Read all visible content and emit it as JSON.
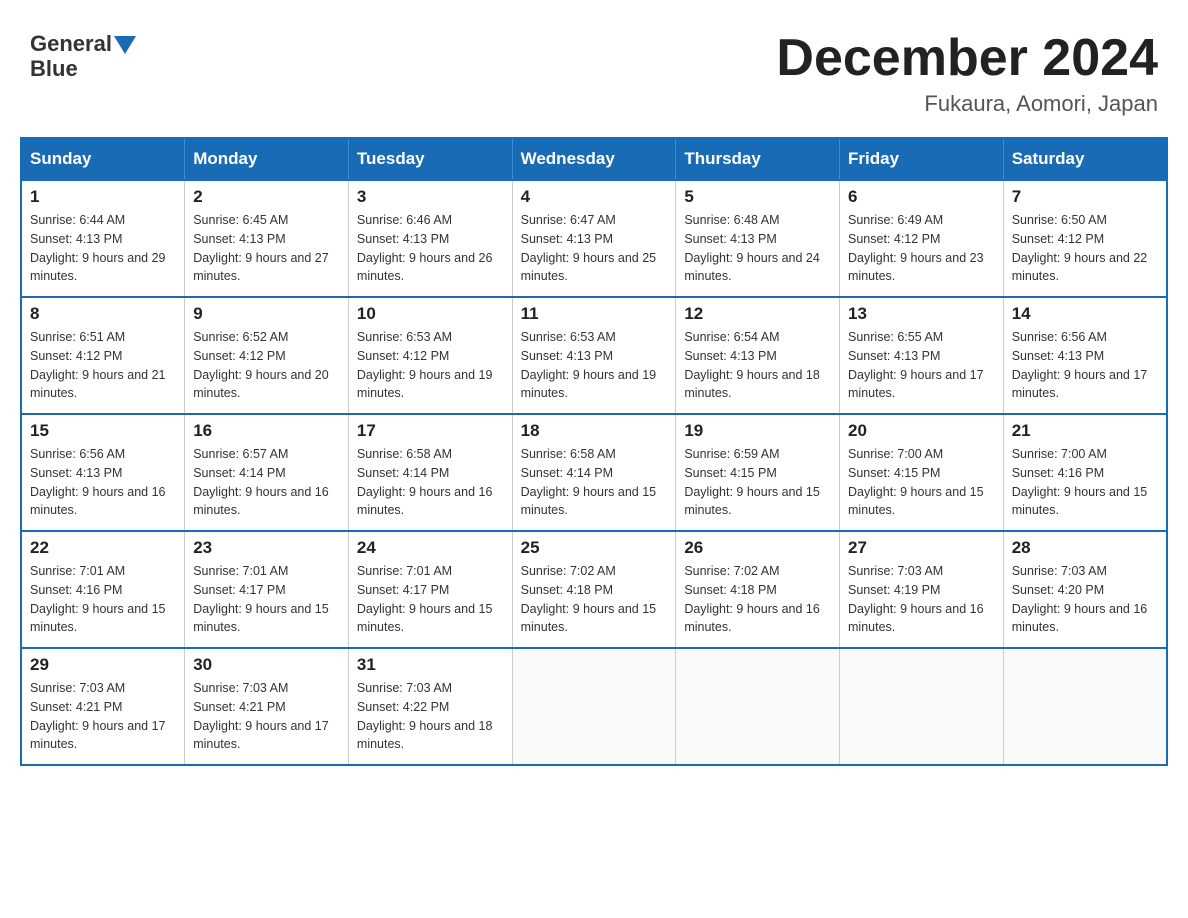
{
  "header": {
    "logo_text_general": "General",
    "logo_text_blue": "Blue",
    "month_title": "December 2024",
    "location": "Fukaura, Aomori, Japan"
  },
  "days_of_week": [
    "Sunday",
    "Monday",
    "Tuesday",
    "Wednesday",
    "Thursday",
    "Friday",
    "Saturday"
  ],
  "weeks": [
    [
      {
        "day": "1",
        "sunrise": "6:44 AM",
        "sunset": "4:13 PM",
        "daylight": "9 hours and 29 minutes."
      },
      {
        "day": "2",
        "sunrise": "6:45 AM",
        "sunset": "4:13 PM",
        "daylight": "9 hours and 27 minutes."
      },
      {
        "day": "3",
        "sunrise": "6:46 AM",
        "sunset": "4:13 PM",
        "daylight": "9 hours and 26 minutes."
      },
      {
        "day": "4",
        "sunrise": "6:47 AM",
        "sunset": "4:13 PM",
        "daylight": "9 hours and 25 minutes."
      },
      {
        "day": "5",
        "sunrise": "6:48 AM",
        "sunset": "4:13 PM",
        "daylight": "9 hours and 24 minutes."
      },
      {
        "day": "6",
        "sunrise": "6:49 AM",
        "sunset": "4:12 PM",
        "daylight": "9 hours and 23 minutes."
      },
      {
        "day": "7",
        "sunrise": "6:50 AM",
        "sunset": "4:12 PM",
        "daylight": "9 hours and 22 minutes."
      }
    ],
    [
      {
        "day": "8",
        "sunrise": "6:51 AM",
        "sunset": "4:12 PM",
        "daylight": "9 hours and 21 minutes."
      },
      {
        "day": "9",
        "sunrise": "6:52 AM",
        "sunset": "4:12 PM",
        "daylight": "9 hours and 20 minutes."
      },
      {
        "day": "10",
        "sunrise": "6:53 AM",
        "sunset": "4:12 PM",
        "daylight": "9 hours and 19 minutes."
      },
      {
        "day": "11",
        "sunrise": "6:53 AM",
        "sunset": "4:13 PM",
        "daylight": "9 hours and 19 minutes."
      },
      {
        "day": "12",
        "sunrise": "6:54 AM",
        "sunset": "4:13 PM",
        "daylight": "9 hours and 18 minutes."
      },
      {
        "day": "13",
        "sunrise": "6:55 AM",
        "sunset": "4:13 PM",
        "daylight": "9 hours and 17 minutes."
      },
      {
        "day": "14",
        "sunrise": "6:56 AM",
        "sunset": "4:13 PM",
        "daylight": "9 hours and 17 minutes."
      }
    ],
    [
      {
        "day": "15",
        "sunrise": "6:56 AM",
        "sunset": "4:13 PM",
        "daylight": "9 hours and 16 minutes."
      },
      {
        "day": "16",
        "sunrise": "6:57 AM",
        "sunset": "4:14 PM",
        "daylight": "9 hours and 16 minutes."
      },
      {
        "day": "17",
        "sunrise": "6:58 AM",
        "sunset": "4:14 PM",
        "daylight": "9 hours and 16 minutes."
      },
      {
        "day": "18",
        "sunrise": "6:58 AM",
        "sunset": "4:14 PM",
        "daylight": "9 hours and 15 minutes."
      },
      {
        "day": "19",
        "sunrise": "6:59 AM",
        "sunset": "4:15 PM",
        "daylight": "9 hours and 15 minutes."
      },
      {
        "day": "20",
        "sunrise": "7:00 AM",
        "sunset": "4:15 PM",
        "daylight": "9 hours and 15 minutes."
      },
      {
        "day": "21",
        "sunrise": "7:00 AM",
        "sunset": "4:16 PM",
        "daylight": "9 hours and 15 minutes."
      }
    ],
    [
      {
        "day": "22",
        "sunrise": "7:01 AM",
        "sunset": "4:16 PM",
        "daylight": "9 hours and 15 minutes."
      },
      {
        "day": "23",
        "sunrise": "7:01 AM",
        "sunset": "4:17 PM",
        "daylight": "9 hours and 15 minutes."
      },
      {
        "day": "24",
        "sunrise": "7:01 AM",
        "sunset": "4:17 PM",
        "daylight": "9 hours and 15 minutes."
      },
      {
        "day": "25",
        "sunrise": "7:02 AM",
        "sunset": "4:18 PM",
        "daylight": "9 hours and 15 minutes."
      },
      {
        "day": "26",
        "sunrise": "7:02 AM",
        "sunset": "4:18 PM",
        "daylight": "9 hours and 16 minutes."
      },
      {
        "day": "27",
        "sunrise": "7:03 AM",
        "sunset": "4:19 PM",
        "daylight": "9 hours and 16 minutes."
      },
      {
        "day": "28",
        "sunrise": "7:03 AM",
        "sunset": "4:20 PM",
        "daylight": "9 hours and 16 minutes."
      }
    ],
    [
      {
        "day": "29",
        "sunrise": "7:03 AM",
        "sunset": "4:21 PM",
        "daylight": "9 hours and 17 minutes."
      },
      {
        "day": "30",
        "sunrise": "7:03 AM",
        "sunset": "4:21 PM",
        "daylight": "9 hours and 17 minutes."
      },
      {
        "day": "31",
        "sunrise": "7:03 AM",
        "sunset": "4:22 PM",
        "daylight": "9 hours and 18 minutes."
      },
      null,
      null,
      null,
      null
    ]
  ]
}
